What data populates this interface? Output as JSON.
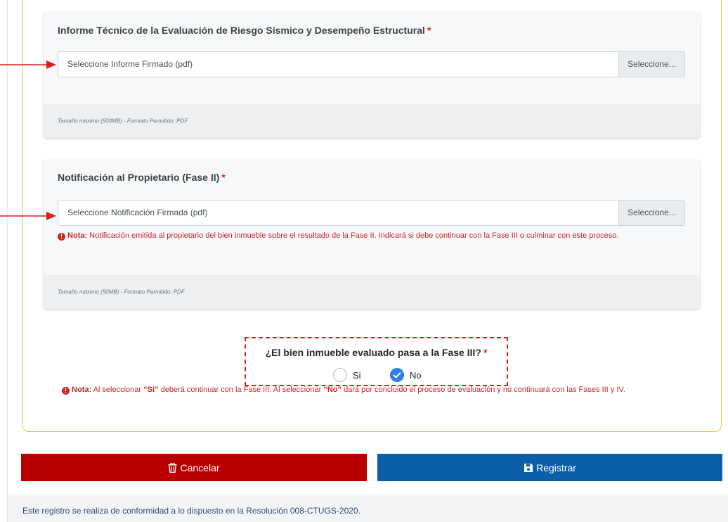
{
  "card1": {
    "title": "Informe Técnico de la Evaluación de Riesgo Sísmico y Desempeño Estructural",
    "required_mark": "*",
    "placeholder": "Seleccione Informe Firmado (pdf)",
    "button": "Seleccione...",
    "footer": "Tamaño máximo (500MB)  -  Formato Permitido: PDF"
  },
  "card2": {
    "title": "Notificación al Propietario (Fase II)",
    "required_mark": "*",
    "placeholder": "Seleccione Notificación Firmada (pdf)",
    "button": "Seleccione...",
    "note_prefix": "Nota:",
    "note_text": "Notificación emitida al propietario del bien inmueble sobre el resultado de la Fase II. Indicará si debe continuar con la Fase III o culminar con este proceso.",
    "footer": "Tamaño máximo (50MB)  -  Formato Permitido: PDF"
  },
  "question": {
    "label": "¿El bien inmueble evaluado pasa a la Fase III?",
    "required_mark": "*",
    "options": [
      {
        "label": "Si",
        "selected": false
      },
      {
        "label": "No",
        "selected": true
      }
    ]
  },
  "bottom_note": {
    "prefix": "Nota:",
    "part1": "Al seleccionar",
    "quote_si": "“Si”",
    "part2": "deberá continuar con la Fase III. Al seleccionar",
    "quote_no": "“No”",
    "part3": "dará por concluido el proceso de evaluación y no continuará con las Fases III y IV."
  },
  "actions": {
    "cancel_label": "Cancelar",
    "save_label": "Registrar"
  },
  "footer": {
    "text": "Este registro se realiza de conformidad a lo dispuesto en la Resolución 008-CTUGS-2020."
  },
  "colors": {
    "accent_border": "#f0c030",
    "required": "#d32f2f",
    "cancel": "#b90000",
    "save": "#0a5fa8",
    "radio_checked": "#2f7fe0",
    "annotation": "#e01b1b"
  },
  "icons": {
    "note": "exclamation-circle-icon",
    "cancel": "trash-icon",
    "save": "floppy-disk-icon",
    "arrow": "arrow-right-icon"
  }
}
